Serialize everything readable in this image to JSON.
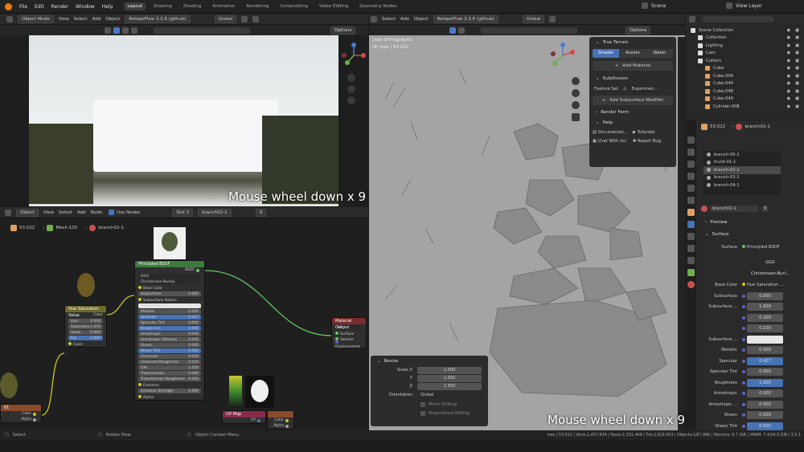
{
  "topbar": {
    "menus": [
      "File",
      "Edit",
      "Render",
      "Window",
      "Help"
    ],
    "workspaces": [
      "Layout",
      "Drawing",
      "Shading",
      "Animation",
      "Rendering",
      "Compositing",
      "Video Editing",
      "Geometry Nodes"
    ],
    "active_workspace": "Layout",
    "scene": "Scene",
    "view_layer": "View Layer"
  },
  "viewport_left": {
    "mode": "Object Mode",
    "menus": [
      "View",
      "Select",
      "Add",
      "Object"
    ],
    "addon": "RetopoFlow 3.2.6 (github)",
    "transform": "Global",
    "options": "Options",
    "caption": "Mouse wheel down x 9"
  },
  "viewport_right": {
    "menus": [
      "Select",
      "Add",
      "Object"
    ],
    "addon": "RetopoFlow 3.2.6 (github)",
    "transform": "Global",
    "options": "Options",
    "view_name": "User Orthographic",
    "view_sub": "(4) tree | 53.022",
    "caption": "Mouse wheel down x 9"
  },
  "true_terrain": {
    "title": "True Terrain",
    "tabs": [
      "Shader",
      "Assets",
      "Water"
    ],
    "active_tab": "Shader",
    "add_material": "Add Material",
    "subdivision": "Subdivision",
    "feature_set_label": "Feature Set",
    "feature_set_value": "Experimen...",
    "add_subsurface": "Add Subsurface Modifier",
    "render_farm": "Render Farm",
    "help": "Help",
    "documentation": "Documentat...",
    "tutorials": "Tutorials",
    "chat": "Chat With Us!",
    "report_bug": "Report Bug"
  },
  "redo_panel": {
    "title": "Resize",
    "scale_x_label": "Scale X",
    "scale_x": "1.000",
    "y_label": "Y",
    "y": "1.000",
    "z_label": "Z",
    "z": "1.905",
    "orientation_label": "Orientation",
    "orientation": "Global",
    "mirror_editing": "Mirror Editing",
    "proportional_editing": "Proportional Editing"
  },
  "node_editor": {
    "type": "Object",
    "menus": [
      "View",
      "Select",
      "Add",
      "Node"
    ],
    "use_nodes": "Use Nodes",
    "slot": "Slot 3",
    "material": "branch02-1",
    "users": "9",
    "breadcrumb": [
      "53.022",
      "Mesh.120",
      "branch02-1"
    ],
    "hsv_node": {
      "title": "Hue Saturation Value",
      "color_out": "Color",
      "hue_label": "Hue",
      "hue": "0.500",
      "sat_label": "Saturation",
      "sat": "1.070",
      "val_label": "Value",
      "val": "0.800",
      "fac_label": "Fac",
      "fac": "1.000",
      "color_in": "Color"
    },
    "bsdf_node": {
      "title": "Principled BSDF",
      "bsdf_out": "BSDF",
      "distribution": "GGX",
      "subsurface_method": "Christensen-Burley",
      "rows": [
        {
          "label": "Base Color",
          "value": "",
          "style": "socket"
        },
        {
          "label": "Subsurface",
          "value": "0.000",
          "style": "bar"
        },
        {
          "label": "Subsurface Radius",
          "value": "",
          "style": "socket"
        },
        {
          "label": "Subsurface C...",
          "value": "",
          "style": "white"
        },
        {
          "label": "Metallic",
          "value": "0.000",
          "style": "bar"
        },
        {
          "label": "Specular",
          "value": "0.427",
          "style": "blue"
        },
        {
          "label": "Specular Tint",
          "value": "0.000",
          "style": "bar"
        },
        {
          "label": "Roughness",
          "value": "1.000",
          "style": "blue"
        },
        {
          "label": "Anisotropic",
          "value": "0.000",
          "style": "bar"
        },
        {
          "label": "Anisotropic Rotation",
          "value": "0.000",
          "style": "bar"
        },
        {
          "label": "Sheen",
          "value": "0.000",
          "style": "bar"
        },
        {
          "label": "Sheen Tint",
          "value": "0.500",
          "style": "blue"
        },
        {
          "label": "Clearcoat",
          "value": "0.000",
          "style": "bar"
        },
        {
          "label": "Clearcoat Roughness",
          "value": "0.030",
          "style": "bar"
        },
        {
          "label": "IOR",
          "value": "1.450",
          "style": "bar"
        },
        {
          "label": "Transmission",
          "value": "0.000",
          "style": "bar"
        },
        {
          "label": "Transmission Roughness",
          "value": "0.000",
          "style": "bar"
        },
        {
          "label": "Emission",
          "value": "",
          "style": "socket"
        },
        {
          "label": "Emission Strength",
          "value": "1.000",
          "style": "bar"
        },
        {
          "label": "Alpha",
          "value": "",
          "style": "socket"
        }
      ]
    },
    "output_node": {
      "title": "Material Output",
      "target": "All",
      "surface": "Surface",
      "volume": "Volume",
      "displacement": "Displacement"
    },
    "left_node": {
      "title": "01",
      "color": "Color",
      "alpha": "Alpha"
    },
    "uv_node": {
      "title": "UV Map",
      "uv": "UV"
    },
    "image_node": {
      "title": "",
      "color": "Color",
      "alpha": "Alpha"
    }
  },
  "outliner": {
    "title": "Scene Collection",
    "rows": [
      {
        "name": "Scene Collection",
        "indent": 0,
        "color": "#ddd"
      },
      {
        "name": "Collection",
        "indent": 1,
        "color": "#ddd"
      },
      {
        "name": "Lighting",
        "indent": 1,
        "color": "#ddd"
      },
      {
        "name": "Cam",
        "indent": 1,
        "color": "#ddd"
      },
      {
        "name": "Cutters",
        "indent": 1,
        "color": "#ddd"
      },
      {
        "name": "Cube",
        "indent": 2,
        "color": "#e0a060"
      },
      {
        "name": "Cube.004",
        "indent": 2,
        "color": "#e0a060"
      },
      {
        "name": "Cube.044",
        "indent": 2,
        "color": "#e0a060"
      },
      {
        "name": "Cube.048",
        "indent": 2,
        "color": "#e0a060"
      },
      {
        "name": "Cube.049",
        "indent": 2,
        "color": "#e0a060"
      },
      {
        "name": "Cylinder.008",
        "indent": 2,
        "color": "#e0a060"
      }
    ]
  },
  "properties": {
    "object": "53.022",
    "material": "branch02-1",
    "slots": [
      "branch-05-1",
      "trunk-01-1",
      "branch-02-1",
      "branch-03-1",
      "branch-04-1"
    ],
    "active_slot": "branch-02-1",
    "material_field": "branch02-1",
    "users": "9",
    "preview": "Preview",
    "surface_section": "Surface",
    "surface_label": "Surface",
    "surface_value": "Principled BSDF",
    "distribution": "GGX",
    "subsurface_method": "Christensen-Burl...",
    "base_color_label": "Base Color",
    "base_color_value": "Hue Saturation ...",
    "rows": [
      {
        "label": "Subsurface",
        "value": "0.000",
        "style": "bar"
      },
      {
        "label": "Subsurface ...",
        "value": "1.000",
        "style": "bar"
      },
      {
        "label": "",
        "value": "0.200",
        "style": "bar"
      },
      {
        "label": "",
        "value": "0.100",
        "style": "bar"
      },
      {
        "label": "Subsurface ...",
        "value": "",
        "style": "white"
      },
      {
        "label": "Metallic",
        "value": "0.000",
        "style": "bar"
      },
      {
        "label": "Specular",
        "value": "0.427",
        "style": "blue"
      },
      {
        "label": "Specular Tint",
        "value": "0.000",
        "style": "bar"
      },
      {
        "label": "Roughness",
        "value": "1.000",
        "style": "blue"
      },
      {
        "label": "Anisotropic",
        "value": "0.000",
        "style": "bar"
      },
      {
        "label": "Anisotropic ...",
        "value": "0.000",
        "style": "bar"
      },
      {
        "label": "Sheen",
        "value": "0.000",
        "style": "bar"
      },
      {
        "label": "Sheen Tint",
        "value": "0.500",
        "style": "blue"
      }
    ]
  },
  "statusbar": {
    "select": "Select",
    "rotate": "Rotate View",
    "context": "Object Context Menu",
    "stats": "tree | 53.022 | Verts:1,457,634 | Faces:1,331,469 | Tris:2,629,003 | Objects:1/67,886 | Memory: 8.7 GiB | VRAM: 7.4/24.0 GiB | 3.5.1"
  },
  "colors": {
    "accent": "#4772b3",
    "hsv_header": "#6b6b2b",
    "bsdf_header": "#3d7a3d",
    "output_header": "#7a2b2b",
    "uv_header": "#8a2b4b",
    "image_header": "#8a4b2b"
  }
}
